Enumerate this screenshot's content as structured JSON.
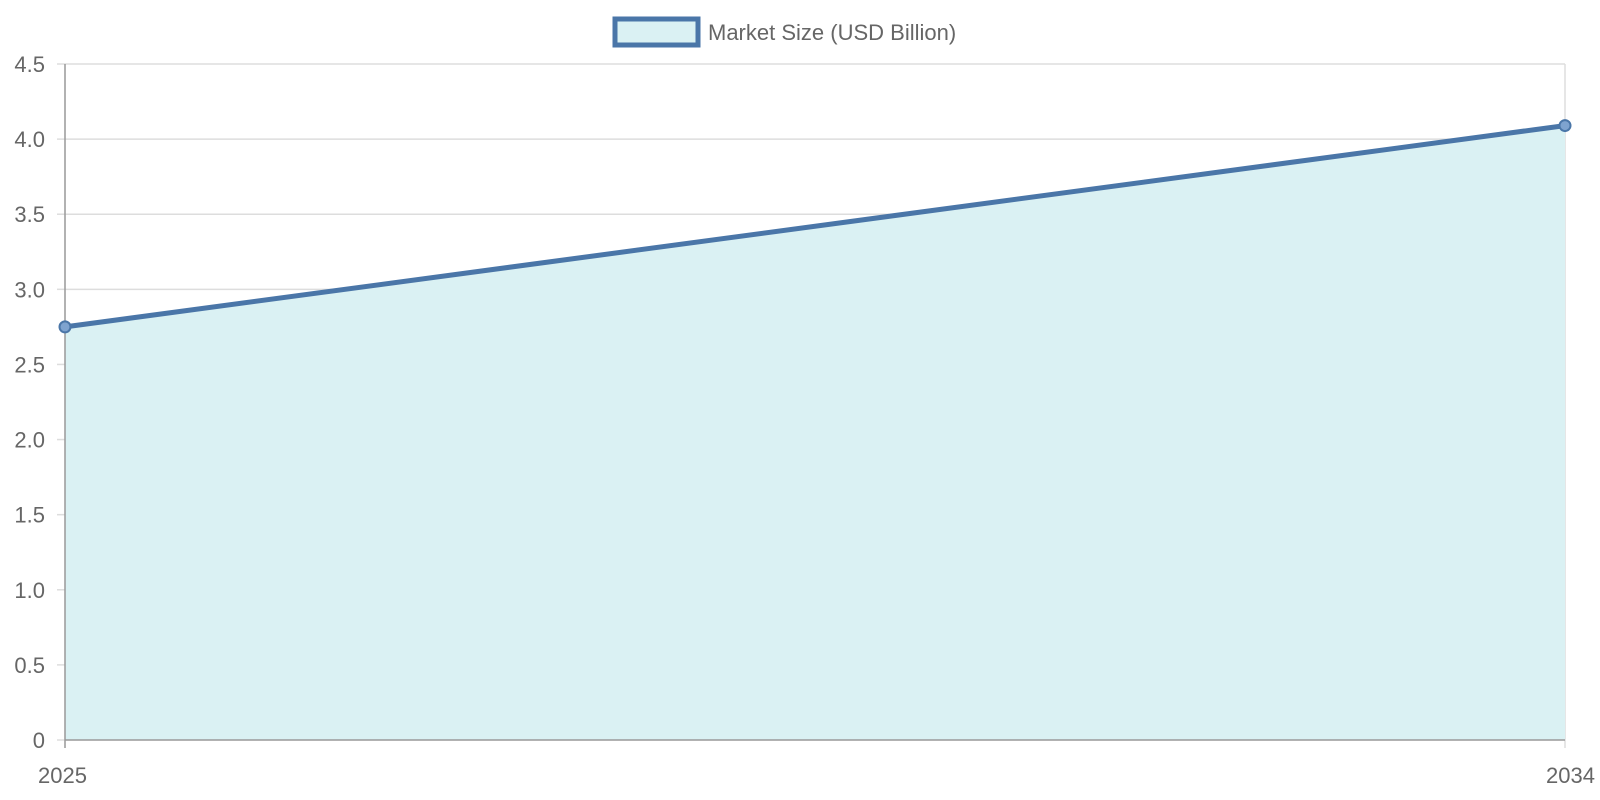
{
  "chart_data": {
    "type": "area",
    "title": "",
    "xlabel": "",
    "ylabel": "",
    "categories": [
      "2025",
      "2034"
    ],
    "series": [
      {
        "name": "Market Size (USD Billion)",
        "values": [
          2.75,
          4.09
        ]
      }
    ],
    "ylim": [
      0,
      4.5
    ],
    "yticks": [
      "0",
      "0.5",
      "1.0",
      "1.5",
      "2.0",
      "2.5",
      "3.0",
      "3.5",
      "4.0",
      "4.5"
    ],
    "grid": true,
    "legend": "top-center",
    "colors": {
      "line": "#4a76a8",
      "fill": "#daf1f3",
      "point_fill": "#7ea3cf",
      "grid": "#dddddd",
      "axis": "#999999",
      "text": "#666666"
    }
  }
}
